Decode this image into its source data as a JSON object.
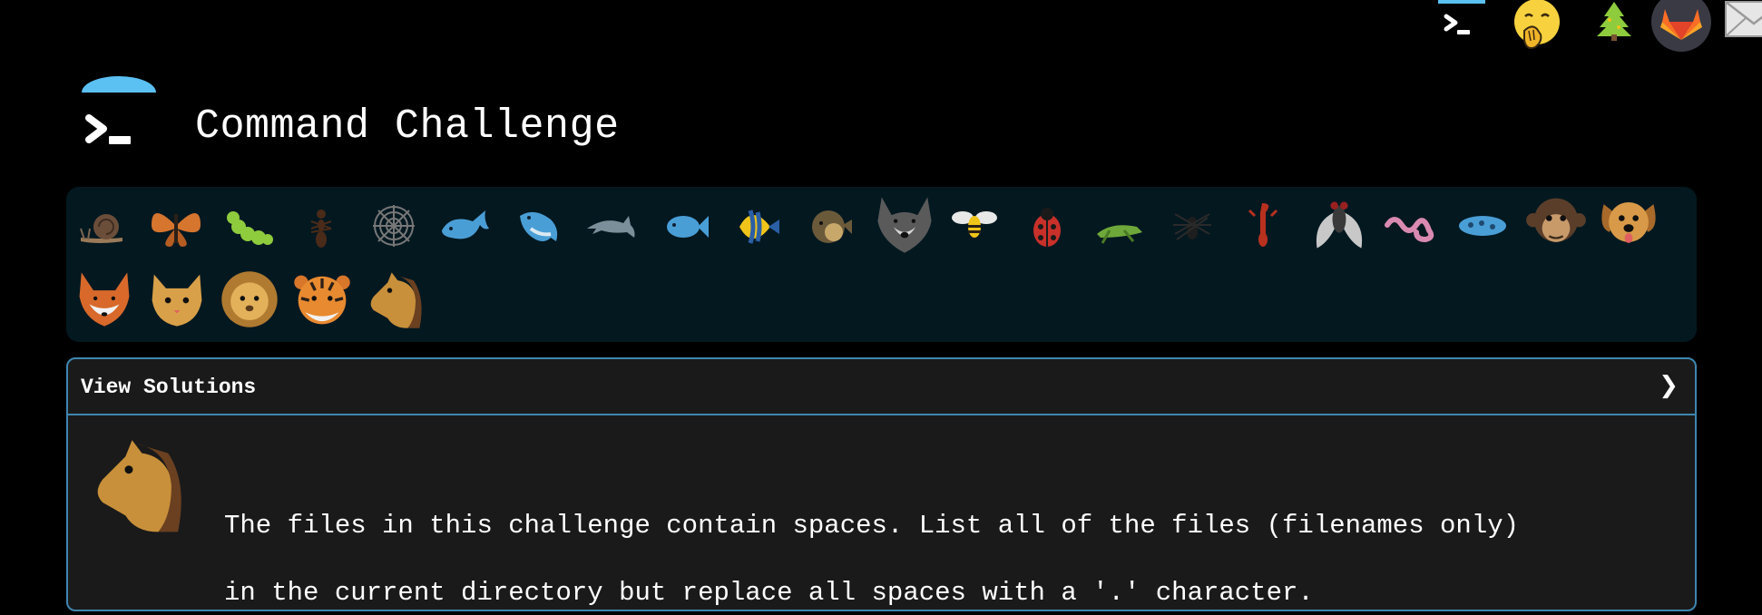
{
  "header": {
    "title": "Command Challenge",
    "logo_icon": "terminal-prompt-icon",
    "accent_color": "#5bc0f2"
  },
  "top_nav": {
    "icons": [
      {
        "name": "terminal-icon"
      },
      {
        "name": "hand-over-mouth-emoji-icon"
      },
      {
        "name": "christmas-tree-icon"
      },
      {
        "name": "gitlab-icon"
      },
      {
        "name": "mail-icon"
      }
    ]
  },
  "challenges": {
    "icons": [
      "snail-icon",
      "butterfly-icon",
      "caterpillar-icon",
      "ant-icon",
      "spider-web-icon",
      "whale-icon",
      "spouting-whale-icon",
      "dolphin-icon",
      "fish-icon",
      "tropical-fish-icon",
      "blowfish-icon",
      "wolf-icon",
      "bee-icon",
      "ladybug-icon",
      "cricket-icon",
      "spider-icon",
      "scorpion-icon",
      "fly-icon",
      "worm-icon",
      "microbe-icon",
      "monkey-icon",
      "dog-icon",
      "fox-icon",
      "cat-icon",
      "lion-icon",
      "tiger-icon",
      "horse-icon"
    ],
    "panel_color": "#041820"
  },
  "solutions": {
    "header_label": "View Solutions",
    "chevron": "❯",
    "border_color": "#3f86b0",
    "card_icon": "horse-icon",
    "description_line1": "The files in this challenge contain spaces. List all of the files (filenames only)",
    "description_line2": "in the current directory but replace all spaces with a '.' character."
  }
}
